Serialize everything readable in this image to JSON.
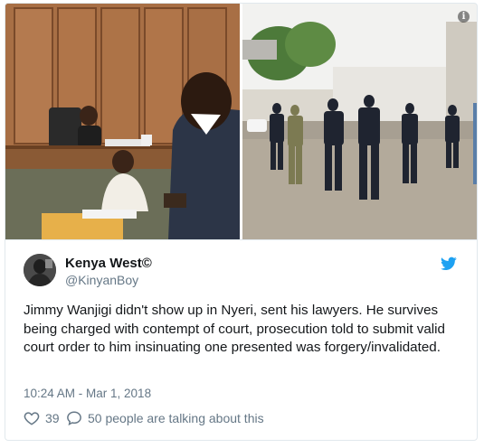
{
  "tweet": {
    "author_name": "Kenya West©",
    "handle": "@KinyanBoy",
    "text": "Jimmy Wanjigi didn't show up in Nyeri, sent his lawyers. He survives being charged with contempt of court, prosecution told to submit valid court order to him insinuating one presented was forgery/invalidated.",
    "timestamp": "10:24 AM - Mar 1, 2018",
    "likes": "39",
    "talking": "50 people are talking about this"
  },
  "icons": {
    "info": "info-icon",
    "bird": "twitter-bird-icon",
    "heart": "heart-icon",
    "reply": "speech-bubble-icon"
  },
  "colors": {
    "twitter_blue": "#1da1f2",
    "secondary_text": "#657786",
    "border": "#e1e8ed"
  }
}
